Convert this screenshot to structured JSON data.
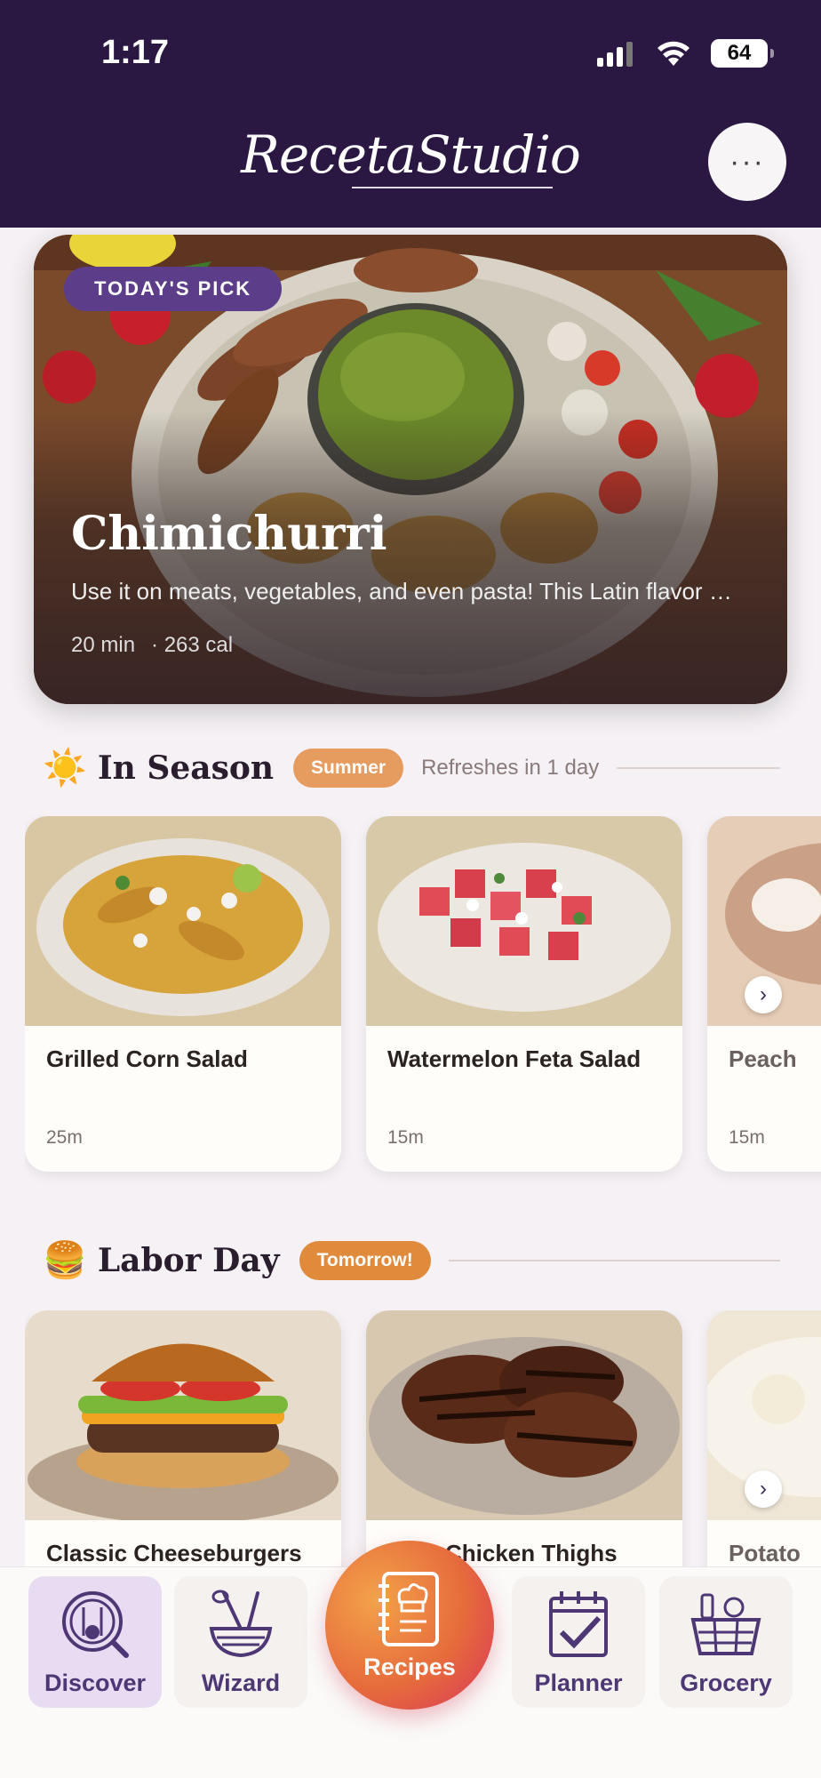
{
  "status_bar": {
    "time": "1:17",
    "battery": "64"
  },
  "header": {
    "logo": "RecetaStudio",
    "menu_label": "···"
  },
  "hero": {
    "badge": "TODAY'S PICK",
    "title": "Chimichurri",
    "description": "Use it on meats, vegetables, and even pasta! This Latin flavor …",
    "time": "20 min",
    "calories": "· 263 cal"
  },
  "in_season": {
    "emoji": "☀️",
    "title": "In Season",
    "pill": "Summer",
    "subtitle": "Refreshes in 1 day",
    "cards": [
      {
        "name": "Grilled Corn Salad",
        "time": "25m"
      },
      {
        "name": "Watermelon Feta Salad",
        "time": "15m"
      },
      {
        "name": "Peach",
        "time": "15m"
      }
    ]
  },
  "labor_day": {
    "emoji": "🍔",
    "title": "Labor Day",
    "pill": "Tomorrow!",
    "cards": [
      {
        "name": "Classic Cheeseburgers",
        "time": ""
      },
      {
        "name": "BBQ Chicken Thighs",
        "time": ""
      },
      {
        "name": "Potato",
        "time": ""
      }
    ]
  },
  "nav": {
    "discover": "Discover",
    "wizard": "Wizard",
    "recipes": "Recipes",
    "planner": "Planner",
    "grocery": "Grocery"
  },
  "colors": {
    "header_bg": "#2a1843",
    "accent_purple": "#5b3d8a",
    "accent_orange": "#e69b5f"
  }
}
